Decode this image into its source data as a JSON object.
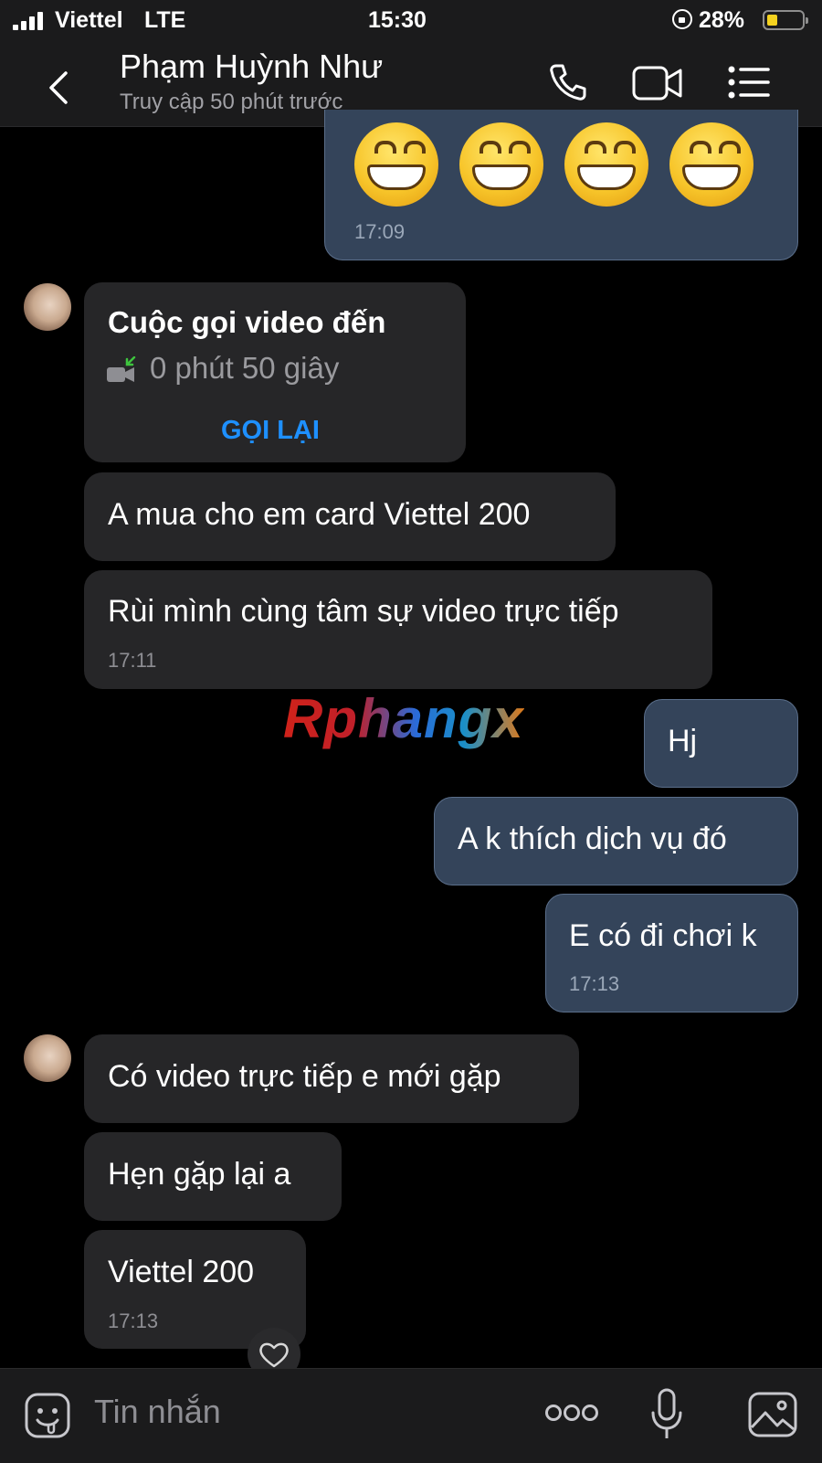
{
  "status_bar": {
    "carrier": "Viettel",
    "network": "LTE",
    "time": "15:30",
    "battery": "28%",
    "battery_level": 0.28
  },
  "header": {
    "contact_name": "Phạm Huỳnh Như",
    "last_seen": "Truy cập 50 phút trước"
  },
  "messages": {
    "out_emoji": {
      "time": "17:09"
    },
    "call": {
      "title": "Cuộc gọi video đến",
      "duration": "0 phút 50 giây",
      "action": "GỌI LẠI"
    },
    "in_1": {
      "text": "A mua cho em card Viettel 200"
    },
    "in_2": {
      "text": "Rùi mình cùng tâm sự video trực tiếp",
      "time": "17:11"
    },
    "out_1": {
      "text": "Hj"
    },
    "out_2": {
      "text": "A k thích dịch vụ đó"
    },
    "out_3": {
      "text": "E có đi chơi k",
      "time": "17:13"
    },
    "in_3": {
      "text": "Có video trực tiếp e mới gặp"
    },
    "in_4": {
      "text": "Hẹn gặp lại a"
    },
    "in_5": {
      "text": "Viettel 200",
      "time": "17:13"
    }
  },
  "watermark": "Rphangx",
  "input": {
    "placeholder": "Tin nhắn"
  },
  "colors": {
    "background": "#000000",
    "incoming_bubble": "#262628",
    "outgoing_bubble": "#34445a",
    "accent": "#1e90ff"
  }
}
